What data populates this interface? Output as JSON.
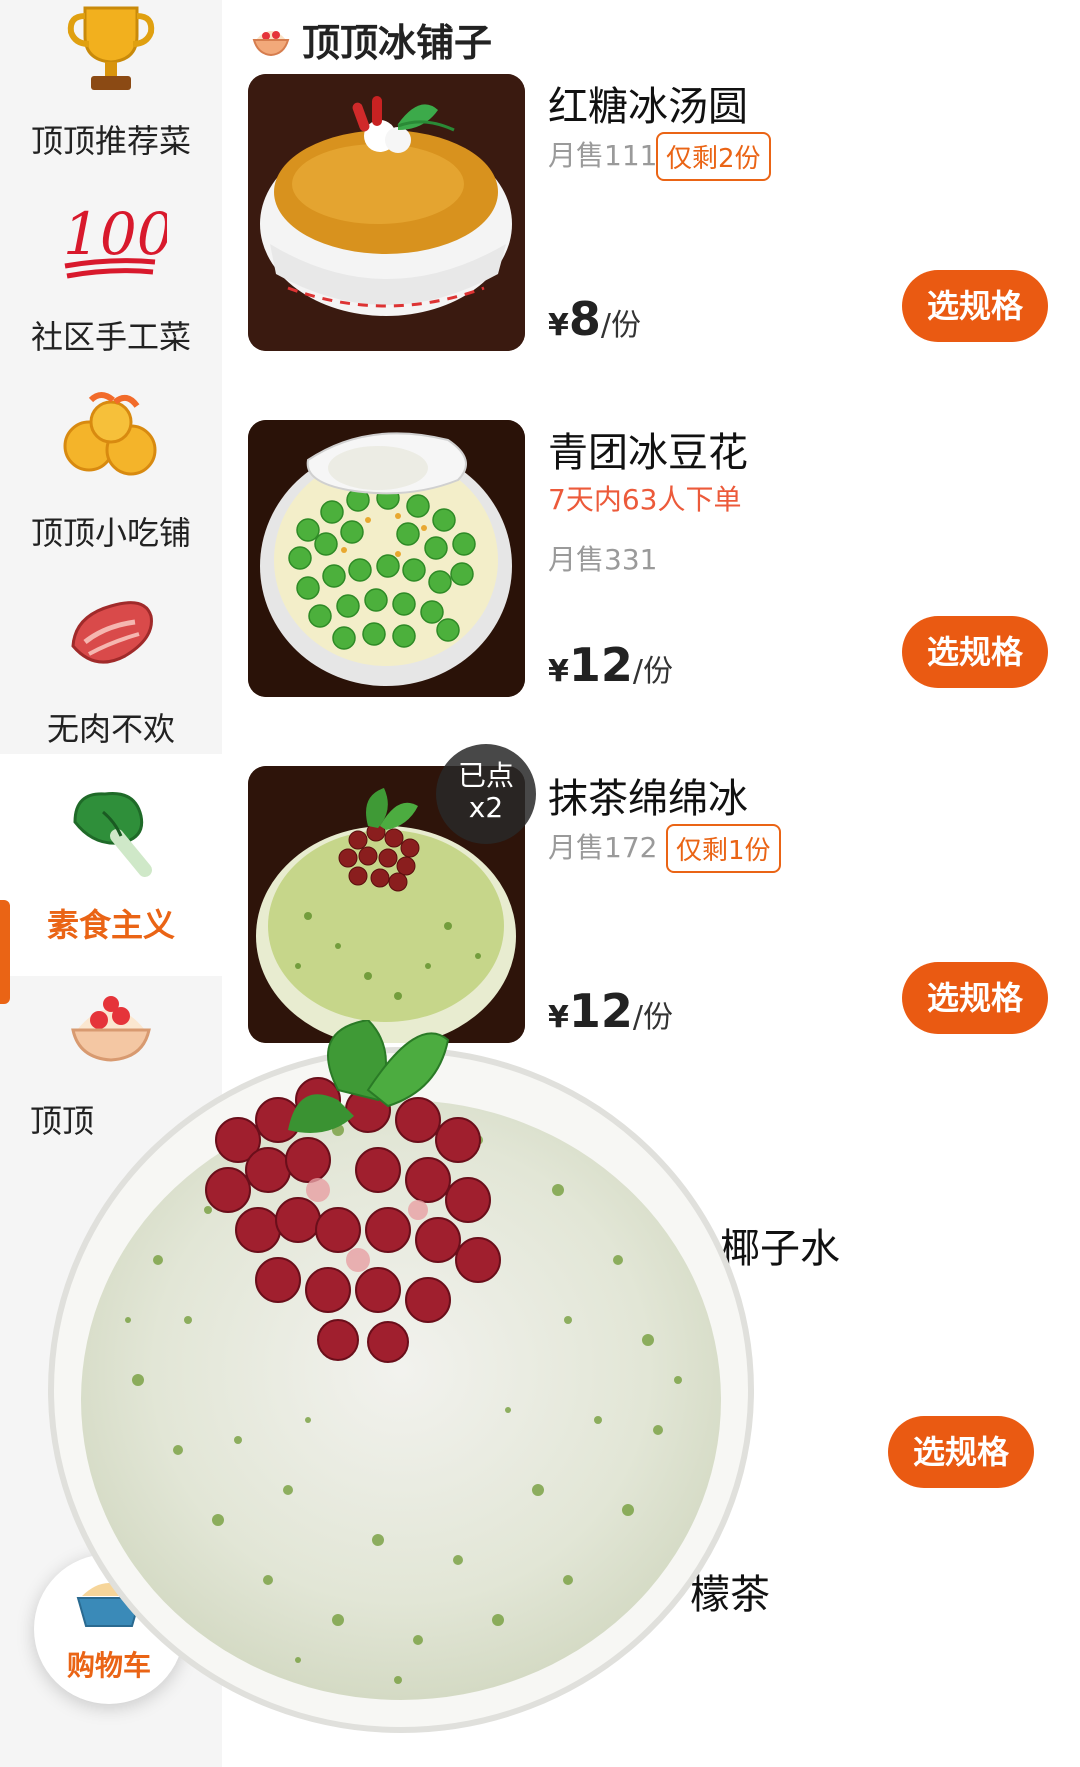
{
  "sidebar": {
    "items": [
      {
        "label": "顶顶推荐菜",
        "icon": "trophy-icon"
      },
      {
        "label": "社区手工菜",
        "icon": "hundred-points-icon"
      },
      {
        "label": "顶顶小吃铺",
        "icon": "shrimp-snack-icon"
      },
      {
        "label": "无肉不欢",
        "icon": "meat-icon"
      },
      {
        "label": "素食主义",
        "icon": "vegetable-icon",
        "active": true
      },
      {
        "label": "顶顶",
        "icon": "shaved-ice-icon"
      }
    ]
  },
  "section": {
    "title": "顶顶冰铺子",
    "icon": "shaved-ice-icon"
  },
  "dishes": [
    {
      "name": "红糖冰汤圆",
      "monthly_sales": "月售111",
      "stock_tag": "仅剩2份",
      "currency": "¥",
      "price": "8",
      "unit": "/份",
      "button": "选规格"
    },
    {
      "name": "青团冰豆花",
      "popularity": "7天内63人下单",
      "monthly_sales": "月售331",
      "currency": "¥",
      "price": "12",
      "unit": "/份",
      "button": "选规格"
    },
    {
      "name": "抹茶绵绵冰",
      "monthly_sales": "月售172",
      "stock_tag": "仅剩1份",
      "currency": "¥",
      "price": "12",
      "unit": "/份",
      "button": "选规格",
      "ordered_badge": {
        "line1": "已点",
        "line2": "x2"
      }
    }
  ],
  "partial_items": [
    {
      "name_fragment": "椰子水",
      "button": "选规格"
    },
    {
      "name_fragment": "檬茶"
    }
  ],
  "cart": {
    "label": "购物车"
  },
  "colors": {
    "accent": "#ea5a12",
    "active_text": "#ea6415",
    "hot_text": "#ec5a3a",
    "sidebar_bg": "#f5f5f5"
  }
}
